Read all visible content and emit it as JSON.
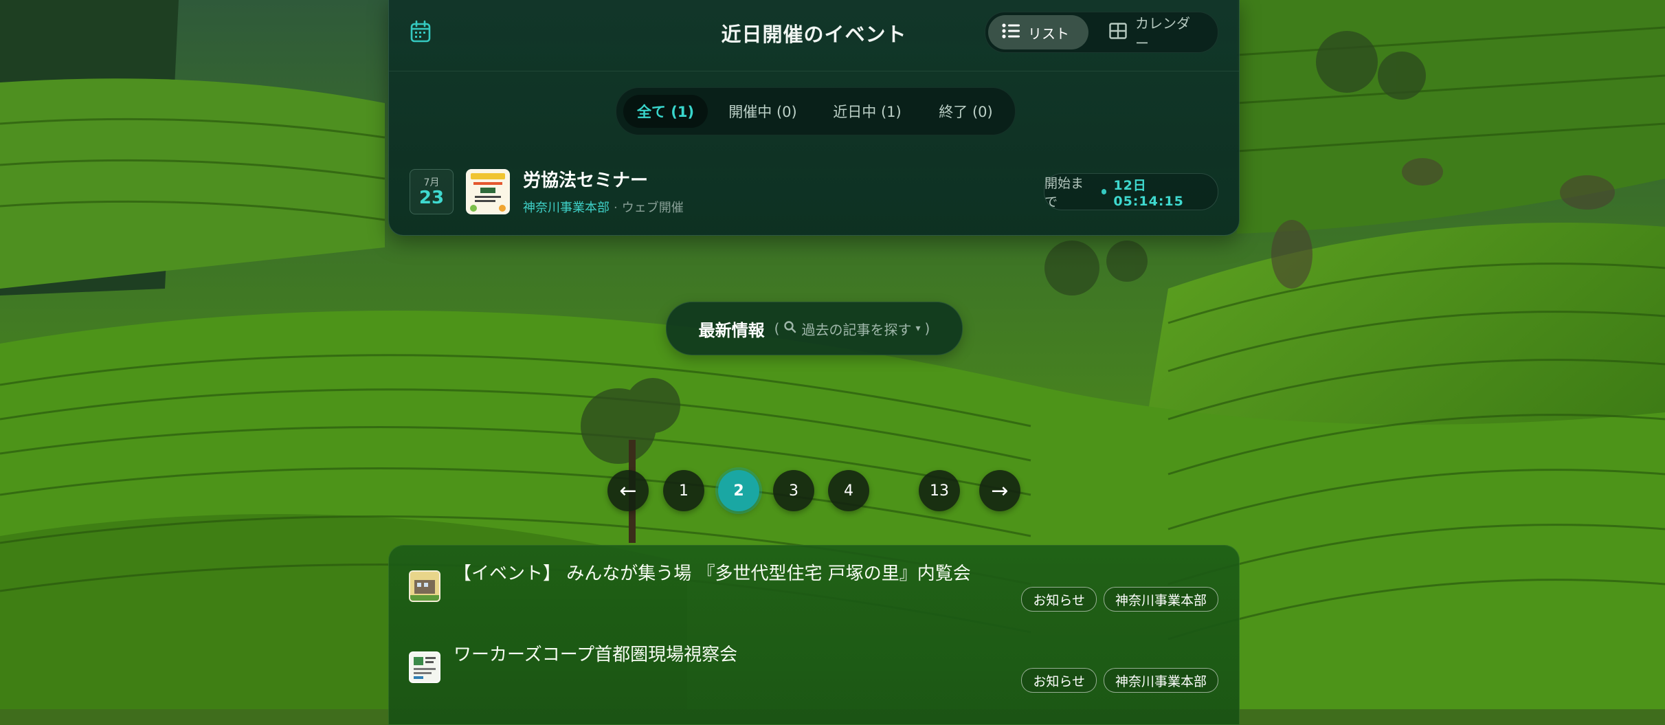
{
  "events": {
    "title": "近日開催のイベント",
    "view_list_label": "リスト",
    "view_calendar_label": "カレンダー",
    "filters": [
      {
        "label": "全て (1)",
        "active": true
      },
      {
        "label": "開催中 (0)",
        "active": false
      },
      {
        "label": "近日中 (1)",
        "active": false
      },
      {
        "label": "終了 (0)",
        "active": false
      }
    ],
    "items": [
      {
        "month": "7月",
        "day": "23",
        "name": "労協法セミナー",
        "org": "神奈川事業本部",
        "separator": "·",
        "venue": "ウェブ開催",
        "countdown_label": "開始まで",
        "countdown_value": "12日  05:14:15"
      }
    ]
  },
  "latest": {
    "title": "最新情報",
    "search_open": "(",
    "search_label": "過去の記事を探す",
    "search_caret": "▾",
    "search_close": ")"
  },
  "pagination": {
    "prev_label": "←",
    "next_label": "→",
    "pages": [
      "1",
      "2",
      "3",
      "4",
      "13"
    ],
    "current": "2"
  },
  "news": [
    {
      "title": "【イベント】 みんなが集う場 『多世代型住宅 戸塚の里』内覧会",
      "tags": [
        "お知らせ",
        "神奈川事業本部"
      ]
    },
    {
      "title": "ワーカーズコープ首都圏現場視察会",
      "tags": [
        "お知らせ",
        "神奈川事業本部"
      ]
    }
  ],
  "colors": {
    "accent": "#3fd9cf",
    "pager_current": "#1aa7a3",
    "panel_bg": "#0f3428"
  }
}
